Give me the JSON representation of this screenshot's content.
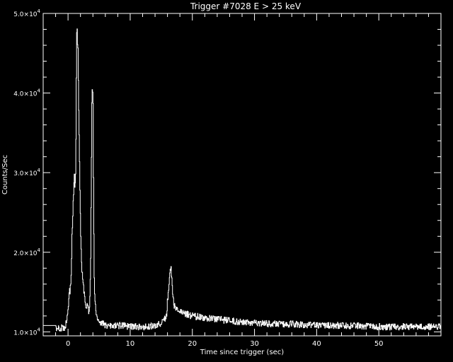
{
  "chart_data": {
    "type": "line",
    "title": "Trigger #7028 E > 25 keV",
    "xlabel": "Time since trigger (sec)",
    "ylabel": "Counts/Sec",
    "xlim": [
      -4,
      60
    ],
    "ylim": [
      9500,
      50000
    ],
    "x_ticks": [
      0,
      10,
      20,
      30,
      40,
      50
    ],
    "y_ticks": [
      {
        "value": 10000,
        "mantissa": "1.0",
        "exp": "4"
      },
      {
        "value": 20000,
        "mantissa": "2.0",
        "exp": "4"
      },
      {
        "value": 30000,
        "mantissa": "3.0",
        "exp": "4"
      },
      {
        "value": 40000,
        "mantissa": "4.0",
        "exp": "4"
      },
      {
        "value": 50000,
        "mantissa": "5.0",
        "exp": "4"
      }
    ],
    "grid": false,
    "colors": {
      "background": "#000000",
      "line": "#ffffff",
      "axes": "#ffffff"
    },
    "series": [
      {
        "x": [
          -4.0,
          -2.0,
          -1.9,
          -0.5,
          0.0,
          0.2,
          0.3,
          0.4,
          0.5,
          0.6,
          0.8,
          1.0,
          1.1,
          1.2,
          1.4,
          1.6,
          1.8,
          2.0,
          2.2,
          2.4,
          2.6,
          2.8,
          3.0,
          3.2,
          3.4,
          3.6,
          3.8,
          3.9,
          4.0,
          4.1,
          4.2,
          4.4,
          4.6,
          4.8,
          5.0,
          5.3,
          5.6,
          6.0,
          7.0,
          8.0,
          10.0,
          12.0,
          14.0,
          15.0,
          15.8,
          16.2,
          16.4,
          16.6,
          16.8,
          17.0,
          17.3,
          17.6,
          18.0,
          19.0,
          20.0,
          22.0,
          25.0,
          28.0,
          32.0,
          36.0,
          40.0,
          44.0,
          48.0,
          52.0,
          56.0,
          60.0
        ],
        "y": [
          10800,
          10800,
          10500,
          10500,
          12500,
          15500,
          15000,
          16000,
          18000,
          22000,
          26000,
          29500,
          28000,
          30000,
          50000,
          44000,
          32000,
          22000,
          18000,
          16000,
          14500,
          13500,
          13200,
          12800,
          12500,
          18000,
          38000,
          40500,
          38000,
          25000,
          16000,
          13000,
          12000,
          11500,
          11500,
          11200,
          11000,
          10800,
          10700,
          10800,
          10700,
          10600,
          10800,
          11000,
          12000,
          16000,
          18500,
          17500,
          15000,
          13500,
          13000,
          12800,
          12500,
          12200,
          12000,
          11800,
          11500,
          11200,
          11000,
          11000,
          10800,
          10800,
          10700,
          10600,
          10700,
          10600
        ]
      }
    ]
  }
}
